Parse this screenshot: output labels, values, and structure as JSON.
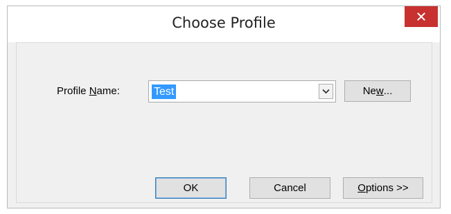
{
  "window": {
    "title": "Choose Profile",
    "close_icon": "close-icon"
  },
  "form": {
    "profile_label_prefix": "Profile ",
    "profile_label_accel": "N",
    "profile_label_suffix": "ame:",
    "profile_value": "Test",
    "dropdown_icon": "chevron-down-icon"
  },
  "buttons": {
    "new_prefix": "Ne",
    "new_accel": "w",
    "new_suffix": "...",
    "ok": "OK",
    "cancel": "Cancel",
    "options_accel": "O",
    "options_suffix": "ptions >>"
  },
  "colors": {
    "close_button": "#c7312f",
    "selection_highlight": "#3399ff",
    "default_button_border": "#3c7fb1"
  }
}
